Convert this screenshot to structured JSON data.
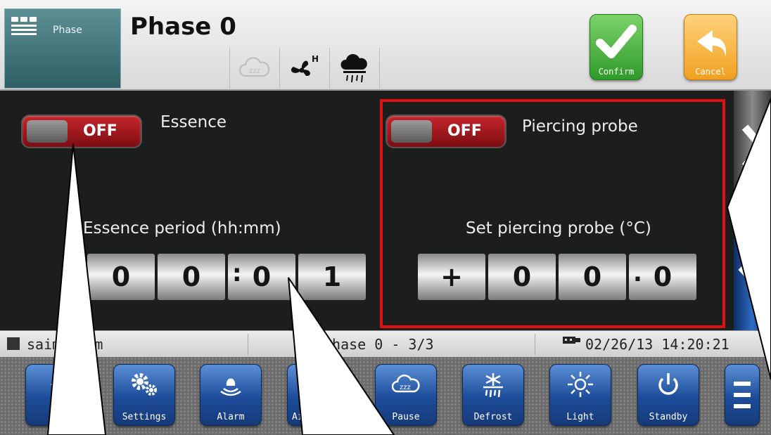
{
  "header": {
    "tab_label": "Phase",
    "title": "Phase 0",
    "mode_icons": [
      "sleep-cloud-icon",
      "fan-high-icon",
      "humidity-cloud-icon"
    ],
    "fan_superscript": "H",
    "confirm_label": "Confirm",
    "cancel_label": "Cancel",
    "confirm_color": "#3aa63a",
    "cancel_color": "#f0a020"
  },
  "left_panel": {
    "toggle_state": "OFF",
    "label": "Essence",
    "period_label": "Essence period (hh:mm)",
    "digits": [
      "0",
      "0",
      "0",
      "1"
    ],
    "separator": ":"
  },
  "right_panel": {
    "toggle_state": "OFF",
    "label": "Piercing probe",
    "set_label": "Set piercing probe (°C)",
    "digits": [
      "+",
      "0",
      "0",
      "0"
    ],
    "separator": "."
  },
  "status_bar": {
    "mode": "saimedium",
    "phase": "Phase 0 - 3/3",
    "datetime": "02/26/13 14:20:21"
  },
  "bottom_bar": {
    "buttons": [
      "E",
      "Settings",
      "Alarm",
      "Ai",
      "Pause",
      "Defrost",
      "Light",
      "Standby"
    ]
  },
  "highlight_color": "#e01010"
}
